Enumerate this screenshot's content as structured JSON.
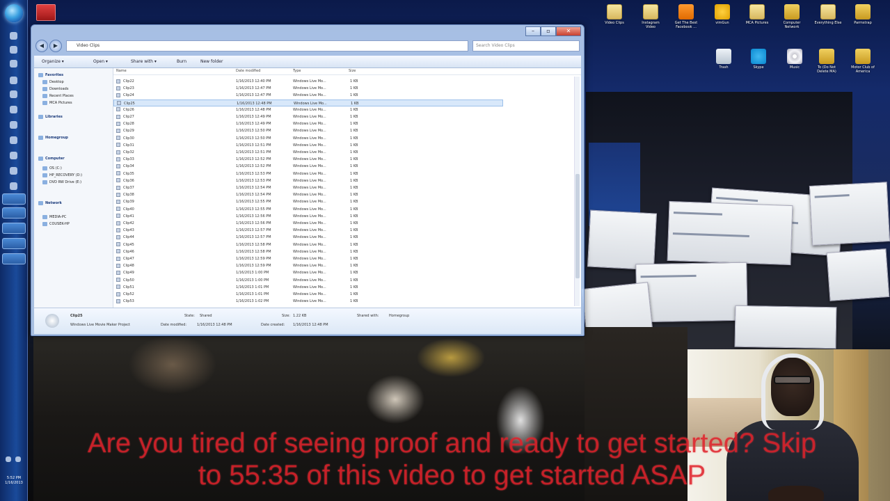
{
  "taskbar": {
    "clock_time": "5:52 PM",
    "clock_date": "1/16/2013"
  },
  "desktop_icons": [
    {
      "label": "Video Clips",
      "icon": "folder-icon"
    },
    {
      "label": "Instagram Video",
      "icon": "folder-icon"
    },
    {
      "label": "Get The Best Facebook ...",
      "icon": "orange-app-icon"
    },
    {
      "label": "vimGun",
      "icon": "vimeo-icon"
    },
    {
      "label": "MCA Pictures",
      "icon": "folder-icon"
    },
    {
      "label": "Computer Network",
      "icon": "lock-icon"
    },
    {
      "label": "Everything Else",
      "icon": "folder-icon"
    },
    {
      "label": "Parmstrap",
      "icon": "lock-icon"
    },
    {
      "label": "Trash",
      "icon": "trash-icon"
    },
    {
      "label": "Skype",
      "icon": "skype-icon"
    },
    {
      "label": "Music",
      "icon": "disc-icon"
    },
    {
      "label": "To (Do Not Delete MA)",
      "icon": "lock-icon"
    },
    {
      "label": "Motor Club of America",
      "icon": "lock-icon"
    }
  ],
  "explorer": {
    "address": "Video Clips",
    "search_placeholder": "Search Video Clips",
    "back_glyph": "◀",
    "forward_glyph": "▶",
    "controls": {
      "minimize": "–",
      "maximize": "▫",
      "close": "✕"
    },
    "toolbar": {
      "organize": "Organize ▾",
      "open": "Open ▾",
      "share_with": "Share with ▾",
      "burn": "Burn",
      "new_folder": "New folder"
    },
    "nav_pane": [
      {
        "label": "Favorites",
        "header": true
      },
      {
        "label": "Desktop",
        "header": false
      },
      {
        "label": "Downloads",
        "header": false
      },
      {
        "label": "Recent Places",
        "header": false
      },
      {
        "label": "MCA Pictures",
        "header": false
      },
      {
        "label": "Libraries",
        "header": true
      },
      {
        "label": "Homegroup",
        "header": true
      },
      {
        "label": "Computer",
        "header": true
      },
      {
        "label": "OS (C:)",
        "header": false
      },
      {
        "label": "HP_RECOVERY (D:)",
        "header": false
      },
      {
        "label": "DVD RW Drive (E:)",
        "header": false
      },
      {
        "label": "Network",
        "header": true
      },
      {
        "label": "MEDIA-PC",
        "header": false
      },
      {
        "label": "COUSEK-HP",
        "header": false
      }
    ],
    "columns": {
      "name": "Name",
      "date": "Date modified",
      "type": "Type",
      "size": "Size"
    },
    "files": [
      {
        "name": "Clip22",
        "date": "1/16/2013 12:40 PM",
        "type": "Windows Live Mo...",
        "size": "1 KB"
      },
      {
        "name": "Clip23",
        "date": "1/16/2013 12:47 PM",
        "type": "Windows Live Mo...",
        "size": "1 KB"
      },
      {
        "name": "Clip24",
        "date": "1/16/2013 12:47 PM",
        "type": "Windows Live Mo...",
        "size": "1 KB"
      },
      {
        "name": "Clip25",
        "date": "1/16/2013 12:48 PM",
        "type": "Windows Live Mo...",
        "size": "1 KB"
      },
      {
        "name": "Clip26",
        "date": "1/16/2013 12:48 PM",
        "type": "Windows Live Mo...",
        "size": "1 KB"
      },
      {
        "name": "Clip27",
        "date": "1/16/2013 12:49 PM",
        "type": "Windows Live Mo...",
        "size": "1 KB"
      },
      {
        "name": "Clip28",
        "date": "1/16/2013 12:49 PM",
        "type": "Windows Live Mo...",
        "size": "1 KB"
      },
      {
        "name": "Clip29",
        "date": "1/16/2013 12:50 PM",
        "type": "Windows Live Mo...",
        "size": "1 KB"
      },
      {
        "name": "Clip30",
        "date": "1/16/2013 12:50 PM",
        "type": "Windows Live Mo...",
        "size": "1 KB"
      },
      {
        "name": "Clip31",
        "date": "1/16/2013 12:51 PM",
        "type": "Windows Live Mo...",
        "size": "1 KB"
      },
      {
        "name": "Clip32",
        "date": "1/16/2013 12:51 PM",
        "type": "Windows Live Mo...",
        "size": "1 KB"
      },
      {
        "name": "Clip33",
        "date": "1/16/2013 12:52 PM",
        "type": "Windows Live Mo...",
        "size": "1 KB"
      },
      {
        "name": "Clip34",
        "date": "1/16/2013 12:52 PM",
        "type": "Windows Live Mo...",
        "size": "1 KB"
      },
      {
        "name": "Clip35",
        "date": "1/16/2013 12:53 PM",
        "type": "Windows Live Mo...",
        "size": "1 KB"
      },
      {
        "name": "Clip36",
        "date": "1/16/2013 12:53 PM",
        "type": "Windows Live Mo...",
        "size": "1 KB"
      },
      {
        "name": "Clip37",
        "date": "1/16/2013 12:54 PM",
        "type": "Windows Live Mo...",
        "size": "1 KB"
      },
      {
        "name": "Clip38",
        "date": "1/16/2013 12:54 PM",
        "type": "Windows Live Mo...",
        "size": "1 KB"
      },
      {
        "name": "Clip39",
        "date": "1/16/2013 12:55 PM",
        "type": "Windows Live Mo...",
        "size": "1 KB"
      },
      {
        "name": "Clip40",
        "date": "1/16/2013 12:55 PM",
        "type": "Windows Live Mo...",
        "size": "1 KB"
      },
      {
        "name": "Clip41",
        "date": "1/16/2013 12:56 PM",
        "type": "Windows Live Mo...",
        "size": "1 KB"
      },
      {
        "name": "Clip42",
        "date": "1/16/2013 12:56 PM",
        "type": "Windows Live Mo...",
        "size": "1 KB"
      },
      {
        "name": "Clip43",
        "date": "1/16/2013 12:57 PM",
        "type": "Windows Live Mo...",
        "size": "1 KB"
      },
      {
        "name": "Clip44",
        "date": "1/16/2013 12:57 PM",
        "type": "Windows Live Mo...",
        "size": "1 KB"
      },
      {
        "name": "Clip45",
        "date": "1/16/2013 12:58 PM",
        "type": "Windows Live Mo...",
        "size": "1 KB"
      },
      {
        "name": "Clip46",
        "date": "1/16/2013 12:58 PM",
        "type": "Windows Live Mo...",
        "size": "1 KB"
      },
      {
        "name": "Clip47",
        "date": "1/16/2013 12:59 PM",
        "type": "Windows Live Mo...",
        "size": "1 KB"
      },
      {
        "name": "Clip48",
        "date": "1/16/2013 12:59 PM",
        "type": "Windows Live Mo...",
        "size": "1 KB"
      },
      {
        "name": "Clip49",
        "date": "1/16/2013 1:00 PM",
        "type": "Windows Live Mo...",
        "size": "1 KB"
      },
      {
        "name": "Clip50",
        "date": "1/16/2013 1:00 PM",
        "type": "Windows Live Mo...",
        "size": "1 KB"
      },
      {
        "name": "Clip51",
        "date": "1/16/2013 1:01 PM",
        "type": "Windows Live Mo...",
        "size": "1 KB"
      },
      {
        "name": "Clip52",
        "date": "1/16/2013 1:01 PM",
        "type": "Windows Live Mo...",
        "size": "1 KB"
      },
      {
        "name": "Clip53",
        "date": "1/16/2013 1:02 PM",
        "type": "Windows Live Mo...",
        "size": "1 KB"
      }
    ],
    "selected_index": 3,
    "details": {
      "name": "Clip25",
      "type": "Windows Live Movie Maker Project",
      "date_modified_label": "Date modified:",
      "date_modified": "1/16/2013 12:48 PM",
      "state_label": "State:",
      "state": "Shared",
      "size_label": "Size:",
      "size": "1.22 KB",
      "date_created_label": "Date created:",
      "date_created": "1/16/2013 12:48 PM",
      "shared_with_label": "Shared with:",
      "shared_with": "Homegroup"
    }
  },
  "caption": {
    "line1": "Are you tired of seeing proof and ready to get started? Skip",
    "line2": "to 55:35 of this video to get started ASAP"
  }
}
